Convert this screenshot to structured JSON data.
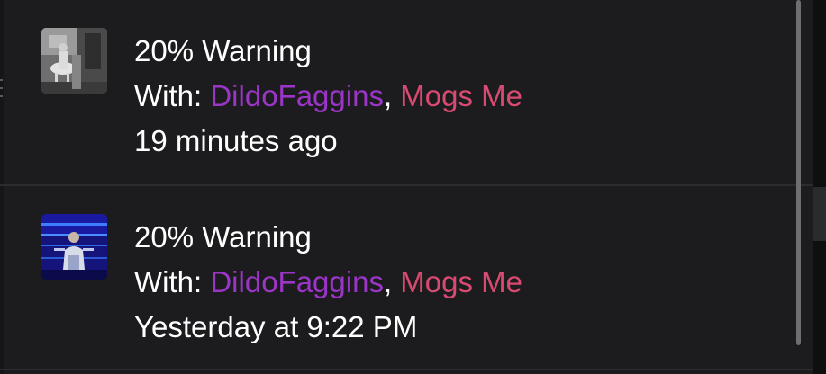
{
  "notifications": [
    {
      "title": "20% Warning",
      "with_label": "With:",
      "separator": ",",
      "participants": [
        {
          "name": "DildoFaggins",
          "color": "#9a35c7"
        },
        {
          "name": "Mogs Me",
          "color": "#d94a72"
        }
      ],
      "time": "19 minutes ago",
      "thumbnail": "grayscale-photo-thumbnail"
    },
    {
      "title": "20% Warning",
      "with_label": "With:",
      "separator": ",",
      "participants": [
        {
          "name": "DildoFaggins",
          "color": "#9a35c7"
        },
        {
          "name": "Mogs Me",
          "color": "#d94a72"
        }
      ],
      "time": "Yesterday at 9:22 PM",
      "thumbnail": "blue-photo-thumbnail"
    }
  ],
  "colors": {
    "background": "#1c1c1e",
    "text": "#ffffff",
    "divider": "#2c2c2f",
    "scrollbar": "#6d6d72"
  }
}
